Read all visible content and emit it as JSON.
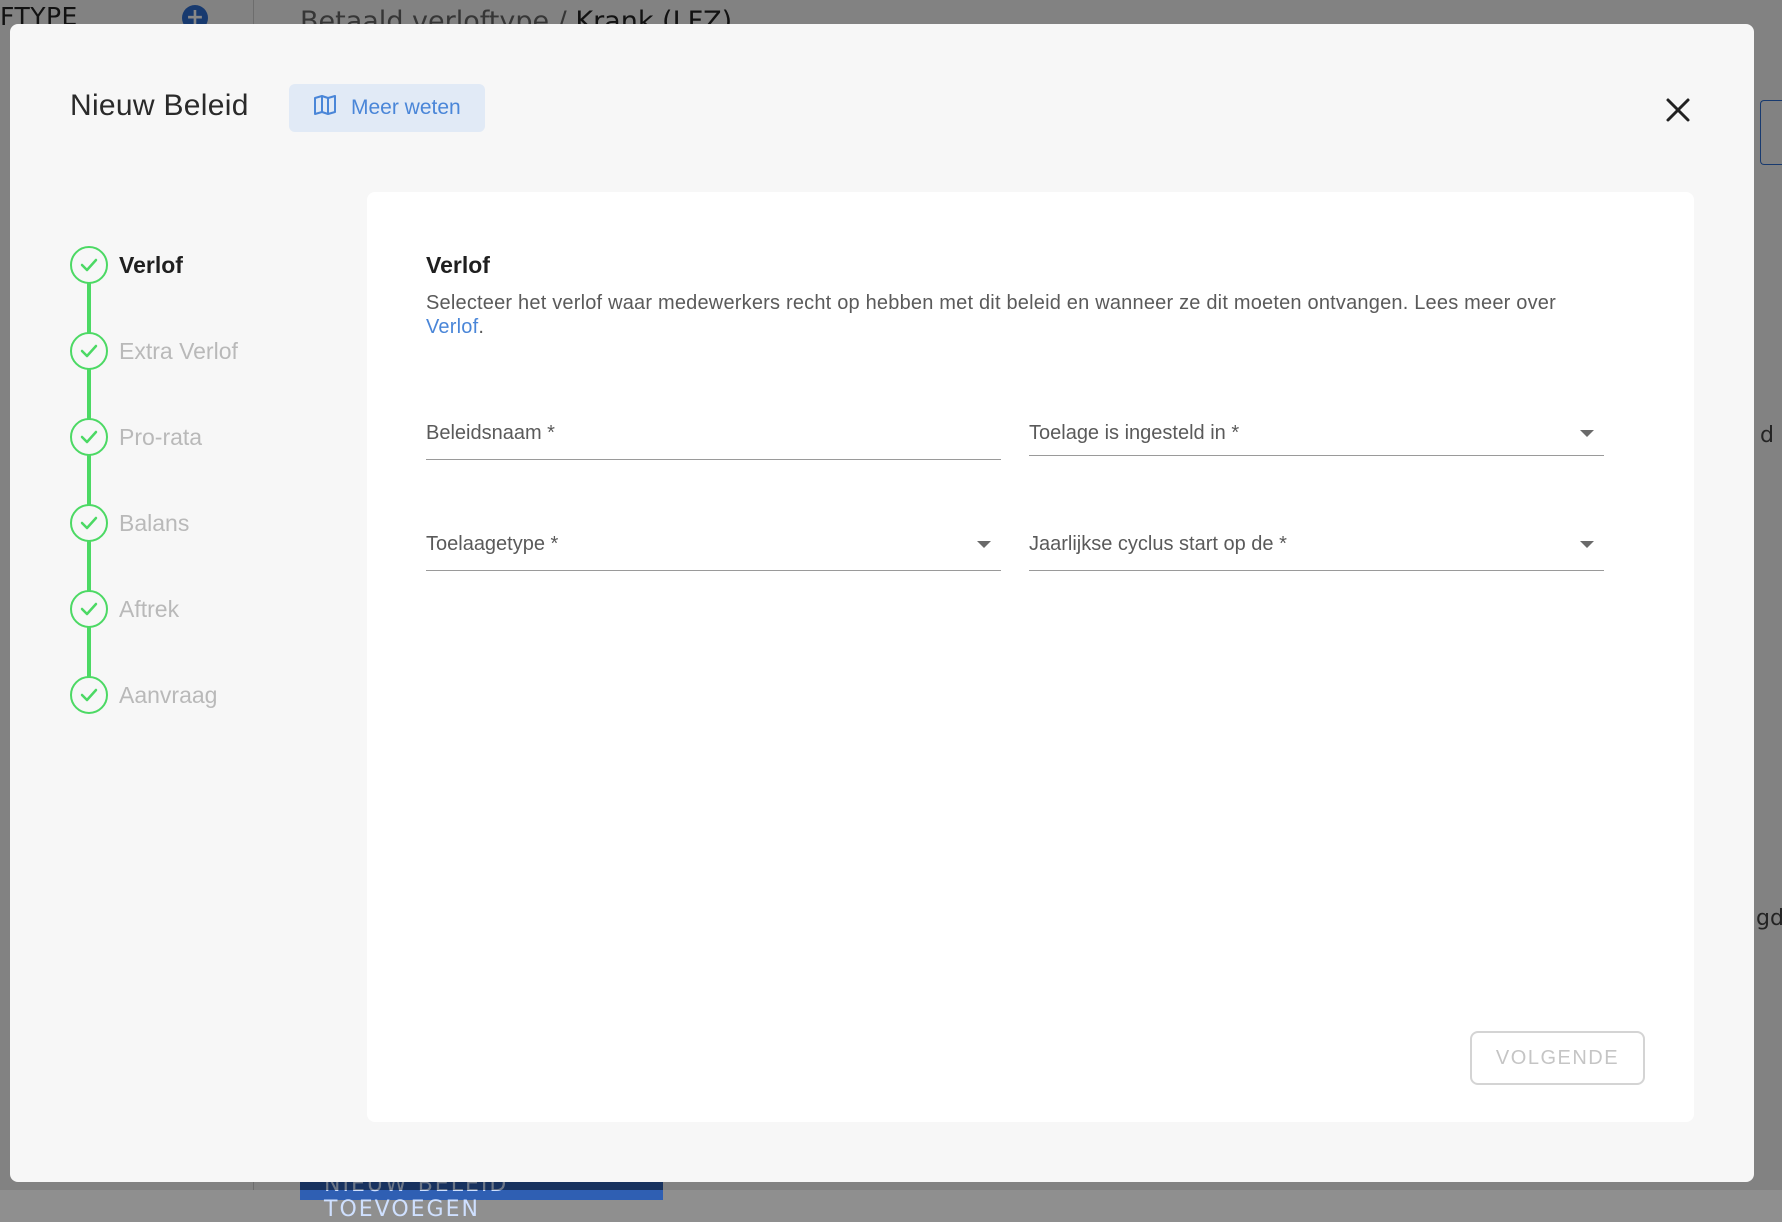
{
  "background": {
    "section_title": "FTYPE",
    "breadcrumb_prefix": "Betaald verloftype / ",
    "breadcrumb_current": "Krank (LFZ)",
    "bottom_button_label": "NIEUW BELEID TOEVOEGEN",
    "right_fragment_1": "d",
    "right_fragment_2": "gd"
  },
  "modal": {
    "title": "Nieuw Beleid",
    "learn_more_label": "Meer weten",
    "close_icon": "close-icon",
    "learn_more_icon": "book-icon"
  },
  "stepper": {
    "steps": [
      {
        "label": "Verlof",
        "state": "active"
      },
      {
        "label": "Extra Verlof",
        "state": "completed"
      },
      {
        "label": "Pro-rata",
        "state": "completed"
      },
      {
        "label": "Balans",
        "state": "completed"
      },
      {
        "label": "Aftrek",
        "state": "completed"
      },
      {
        "label": "Aanvraag",
        "state": "completed"
      }
    ],
    "accent_color": "#4cd964"
  },
  "form": {
    "heading": "Verlof",
    "description_prefix": "Selecteer het verlof waar medewerkers recht op hebben met dit beleid en wanneer ze dit moeten ontvangen. Lees meer over ",
    "description_link": "Verlof",
    "description_suffix": ".",
    "fields": {
      "policy_name": {
        "label": "Beleidsnaam *",
        "value": ""
      },
      "allowance_unit": {
        "label": "Toelage is ingesteld in *",
        "value": ""
      },
      "allowance_type": {
        "label": "Toelaagetype *",
        "value": ""
      },
      "annual_cycle_start": {
        "label": "Jaarlijkse cyclus start op de *",
        "value": ""
      }
    },
    "next_button_label": "VOLGENDE"
  },
  "colors": {
    "link": "#4a86d8",
    "learn_more_bg": "#e1eaf6",
    "step_complete": "#4cd964"
  }
}
